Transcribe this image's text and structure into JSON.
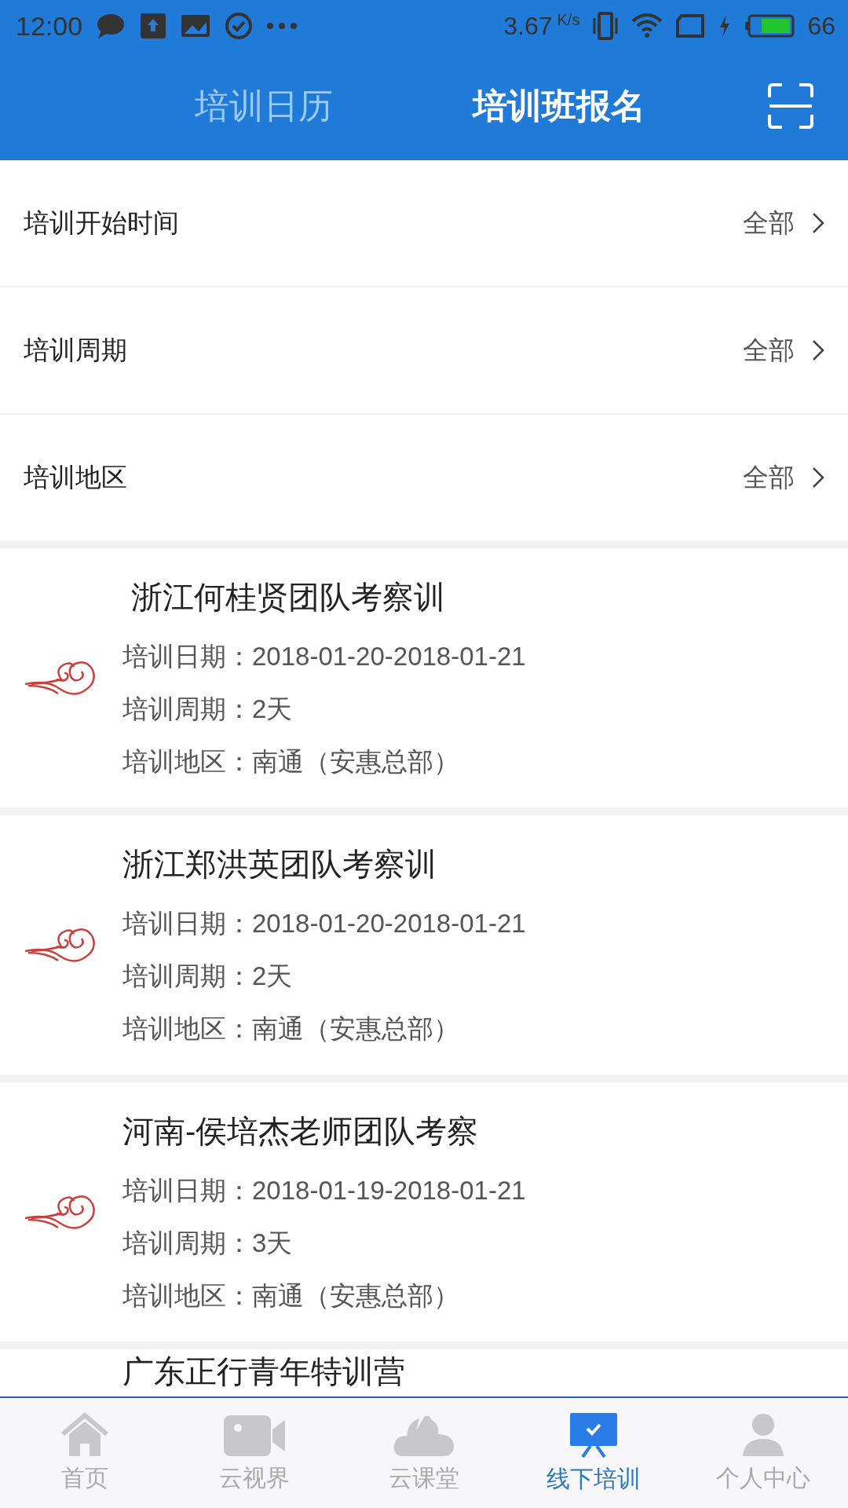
{
  "status_bar": {
    "time": "12:00",
    "speed": "3.67",
    "speed_unit": "K/s",
    "battery": "66"
  },
  "tabs": [
    {
      "label": "培训日历",
      "selected": false
    },
    {
      "label": "培训班报名",
      "selected": true
    }
  ],
  "filters": [
    {
      "label": "培训开始时间",
      "value": "全部"
    },
    {
      "label": "培训周期",
      "value": "全部"
    },
    {
      "label": "培训地区",
      "value": "全部"
    }
  ],
  "courses": [
    {
      "title": " 浙江何桂贤团队考察训",
      "date": "培训日期：2018-01-20-2018-01-21",
      "duration": "培训周期：2天",
      "region": "培训地区：南通（安惠总部）"
    },
    {
      "title": "浙江郑洪英团队考察训",
      "date": "培训日期：2018-01-20-2018-01-21",
      "duration": "培训周期：2天",
      "region": "培训地区：南通（安惠总部）"
    },
    {
      "title": "河南-侯培杰老师团队考察",
      "date": "培训日期：2018-01-19-2018-01-21",
      "duration": "培训周期：3天",
      "region": "培训地区：南通（安惠总部）"
    },
    {
      "title": "广东正行青年特训营"
    }
  ],
  "bottom_nav": [
    {
      "kind": "home",
      "label": "首页",
      "selected": false
    },
    {
      "kind": "video",
      "label": "云视界",
      "selected": false
    },
    {
      "kind": "cloud",
      "label": "云课堂",
      "selected": false
    },
    {
      "kind": "board",
      "label": "线下培训",
      "selected": true
    },
    {
      "kind": "person",
      "label": "个人中心",
      "selected": false
    }
  ]
}
